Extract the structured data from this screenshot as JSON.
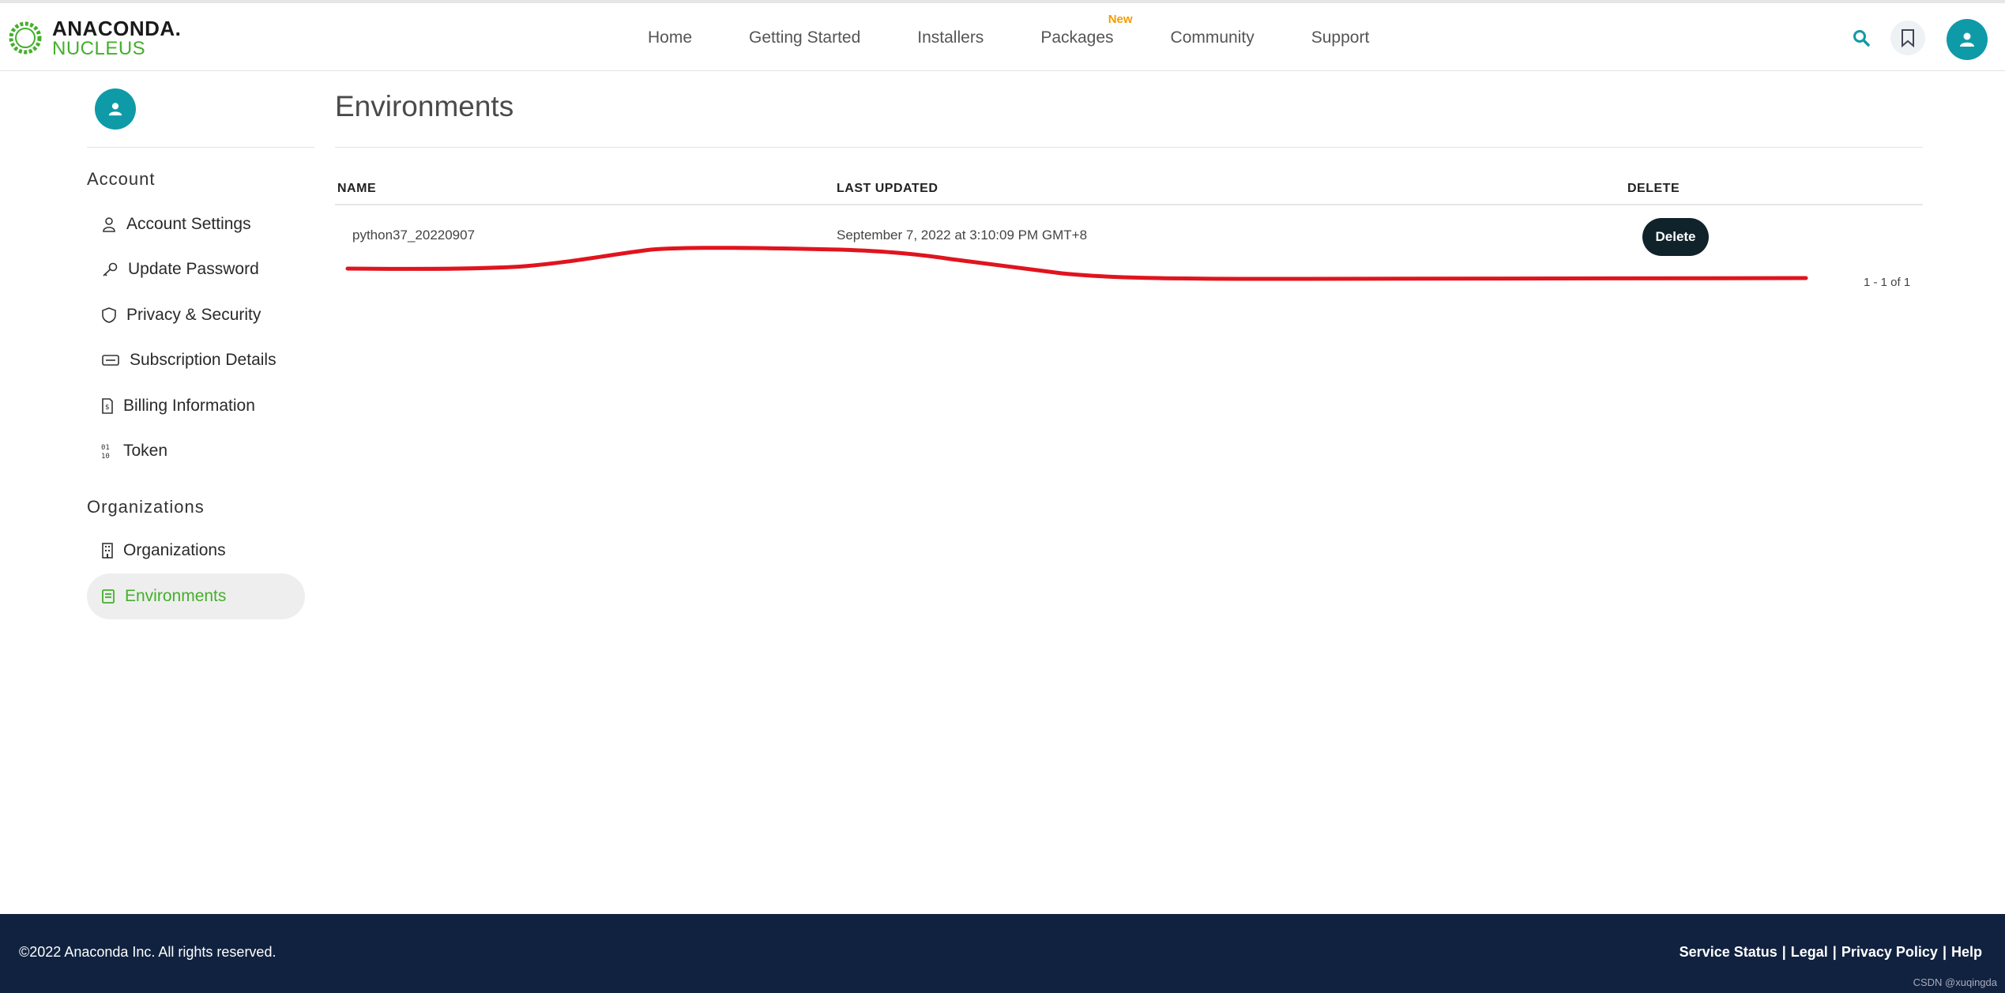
{
  "header": {
    "logo_top": "ANACONDA.",
    "logo_bottom": "NUCLEUS",
    "nav": [
      "Home",
      "Getting Started",
      "Installers",
      "Packages",
      "Community",
      "Support"
    ],
    "new_badge": "New",
    "icons": [
      "search-icon",
      "bookmark-icon",
      "user-avatar-icon"
    ]
  },
  "sidebar": {
    "account_title": "Account",
    "account_items": [
      {
        "label": "Account Settings",
        "icon": "user-icon"
      },
      {
        "label": "Update Password",
        "icon": "key-icon"
      },
      {
        "label": "Privacy & Security",
        "icon": "shield-icon"
      },
      {
        "label": "Subscription Details",
        "icon": "ticket-icon"
      },
      {
        "label": "Billing Information",
        "icon": "invoice-icon"
      },
      {
        "label": "Token",
        "icon": "token-icon"
      }
    ],
    "org_title": "Organizations",
    "org_items": [
      {
        "label": "Organizations",
        "icon": "building-icon"
      },
      {
        "label": "Environments",
        "icon": "environment-icon",
        "active": true
      }
    ]
  },
  "main": {
    "title": "Environments",
    "columns": [
      "NAME",
      "LAST UPDATED",
      "DELETE"
    ],
    "rows": [
      {
        "name": "python37_20220907",
        "last_updated": "September 7, 2022 at 3:10:09 PM GMT+8",
        "action": "Delete"
      }
    ],
    "pagination": "1 - 1 of 1"
  },
  "footer": {
    "copyright": "©2022 Anaconda Inc. All rights reserved.",
    "links": [
      "Service Status",
      "Legal",
      "Privacy Policy",
      "Help"
    ],
    "watermark": "CSDN @xuqingda"
  },
  "colors": {
    "brand_green": "#43b02a",
    "teal": "#0f9aa8",
    "footer_bg": "#10223f",
    "button_dark": "#10232b",
    "annotation_red": "#e0141e"
  }
}
